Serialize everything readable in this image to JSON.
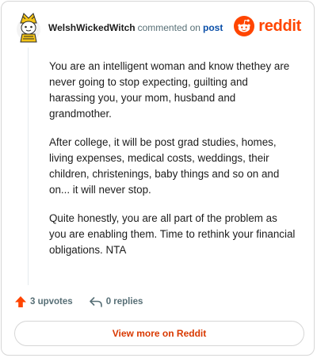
{
  "header": {
    "username": "WelshWickedWitch",
    "action_text": "commented on",
    "post_link": "post",
    "brand": "reddit"
  },
  "comment": {
    "paragraphs": [
      "You are an intelligent woman and know thethey are never going to stop expecting, guilting and harassing you, your mom, husband and grandmother.",
      "After college, it will be post grad studies, homes, living expenses, medical costs, weddings, their children, christenings, baby things and so on and on... it will never stop.",
      "Quite honestly, you are all part of the problem as you are enabling them. Time to rethink your financial obligations. NTA"
    ]
  },
  "actions": {
    "upvotes": "3 upvotes",
    "replies": "0 replies"
  },
  "view_more_label": "View more on Reddit",
  "colors": {
    "brand": "#ff4500",
    "link": "#0a4fa8",
    "muted": "#576f76",
    "view_more": "#d93900"
  }
}
